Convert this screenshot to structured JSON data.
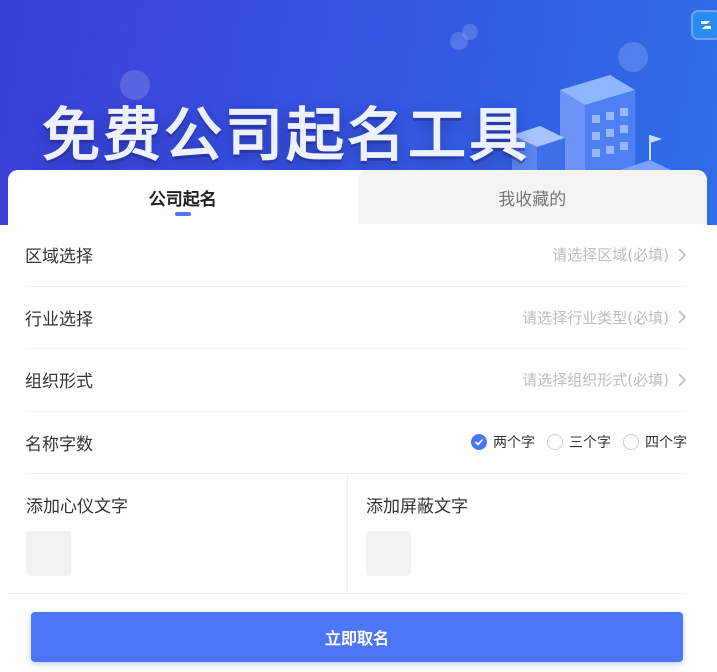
{
  "banner": {
    "title": "免费公司起名工具",
    "corner_icon": "app-logo-icon",
    "colors": {
      "gradient_start": "#3b40d8",
      "gradient_end": "#2f6fe8"
    }
  },
  "tabs": [
    {
      "label": "公司起名",
      "active": true
    },
    {
      "label": "我收藏的",
      "active": false
    }
  ],
  "form": {
    "region": {
      "label": "区域选择",
      "placeholder": "请选择区域(必填)"
    },
    "industry": {
      "label": "行业选择",
      "placeholder": "请选择行业类型(必填)"
    },
    "organization": {
      "label": "组织形式",
      "placeholder": "请选择组织形式(必填)"
    },
    "name_length": {
      "label": "名称字数",
      "options": [
        {
          "label": "两个字",
          "checked": true
        },
        {
          "label": "三个字",
          "checked": false
        },
        {
          "label": "四个字",
          "checked": false
        }
      ]
    },
    "add_preferred": {
      "label": "添加心仪文字"
    },
    "add_blocked": {
      "label": "添加屏蔽文字"
    }
  },
  "submit": {
    "label": "立即取名"
  },
  "colors": {
    "accent": "#4a78f5",
    "button": "#4c76f5"
  }
}
